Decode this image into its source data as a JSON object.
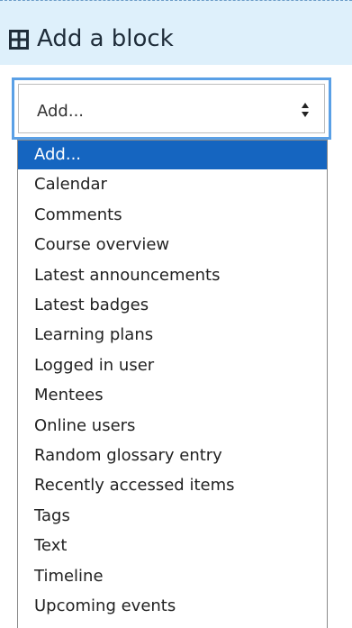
{
  "header": {
    "icon": "add-block-grid-icon",
    "title": "Add a block"
  },
  "select": {
    "value": "Add...",
    "arrow_icon": "sort-updown-icon",
    "options": [
      "Add...",
      "Calendar",
      "Comments",
      "Course overview",
      "Latest announcements",
      "Latest badges",
      "Learning plans",
      "Logged in user",
      "Mentees",
      "Online users",
      "Random glossary entry",
      "Recently accessed items",
      "Tags",
      "Text",
      "Timeline",
      "Upcoming events"
    ]
  },
  "colors": {
    "header_bg": "#def0fb",
    "focus_ring": "#5aa0e6",
    "highlight": "#1565c0"
  }
}
